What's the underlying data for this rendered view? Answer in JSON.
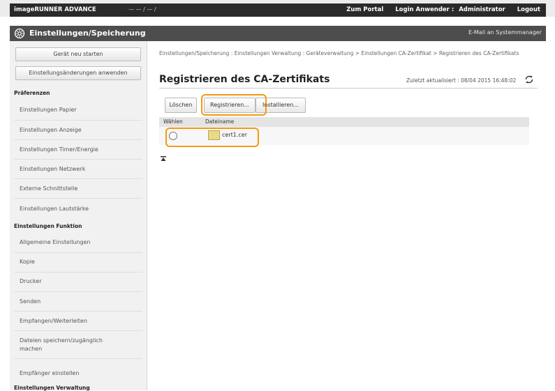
{
  "header": {
    "brand": "imageRUNNER ADVANCE",
    "device": "— — / — /",
    "portal": "Zum Portal",
    "login_label": "Login Anwender :",
    "user": "Administrator",
    "logout": "Logout"
  },
  "titlebar": {
    "title": "Einstellungen/Speicherung",
    "mail": "E-Mail an Systemmanager"
  },
  "sidebar": {
    "restart": "Gerät neu starten",
    "apply": "Einstellungsänderungen anwenden",
    "sec_pref": "Präferenzen",
    "pref_items": [
      "Einstellungen Papier",
      "Einstellungen Anzeige",
      "Einstellungen Timer/Energie",
      "Einstellungen Netzwerk",
      "Externe Schnittstelle",
      "Einstellungen Lautstärke"
    ],
    "sec_func": "Einstellungen Funktion",
    "func_items": [
      "Allgemeine Einstellungen",
      "Kopie",
      "Drucker",
      "Senden",
      "Empfangen/Weiterleiten",
      "Dateien speichern/zugänglich machen",
      "Empfänger einstellen"
    ],
    "sec_admin": "Einstellungen Verwaltung"
  },
  "main": {
    "breadcrumb": "Einstellungen/Speicherung : Einstellungen Verwaltung : Geräteverwaltung > Einstellungen CA-Zertifikat > Registrieren des CA-Zertifikats",
    "title": "Registrieren des CA-Zertifikats",
    "updated": "Zuletzt aktualisiert : 08/04 2015 16:48:02",
    "buttons": {
      "delete": "Löschen",
      "register": "Registrieren...",
      "install": "Installieren..."
    },
    "table": {
      "headers": [
        "Wählen",
        "Dateiname"
      ],
      "rows": [
        {
          "file": "cert1.cer"
        }
      ]
    }
  },
  "colors": {
    "highlight": "#f29a12",
    "header_bg": "#2a2a2a",
    "titlebar_bg": "#4d4d4d"
  }
}
